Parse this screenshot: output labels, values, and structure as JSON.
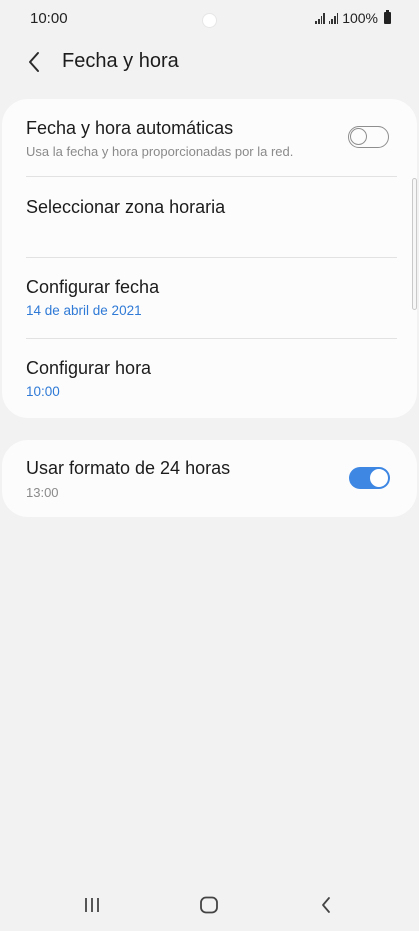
{
  "status": {
    "time": "10:00",
    "battery": "100%"
  },
  "header": {
    "title": "Fecha y hora"
  },
  "settings": {
    "auto_datetime": {
      "label": "Fecha y hora automáticas",
      "description": "Usa la fecha y hora proporcionadas por la red.",
      "enabled": false
    },
    "timezone": {
      "label": "Seleccionar zona horaria"
    },
    "date": {
      "label": "Configurar fecha",
      "value": "14 de abril de 2021"
    },
    "time": {
      "label": "Configurar hora",
      "value": "10:00"
    },
    "format24": {
      "label": "Usar formato de 24 horas",
      "value": "13:00",
      "enabled": true
    }
  },
  "colors": {
    "accent": "#3e87e3",
    "value_blue": "#2f7ad6",
    "background": "#f2f2f2",
    "card": "#fcfcfc"
  },
  "icons": {
    "back": "chevron-left-icon",
    "recents": "recents-icon",
    "home": "home-icon",
    "nav_back": "back-icon"
  }
}
